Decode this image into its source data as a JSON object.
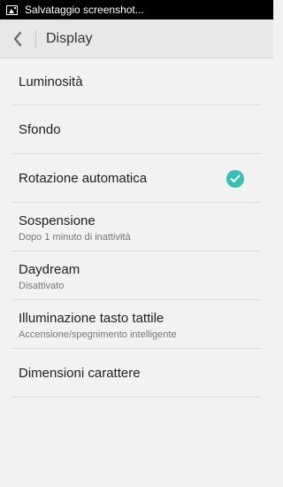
{
  "status_bar": {
    "notification_text": "Salvataggio screenshot...",
    "icon": "image-icon"
  },
  "header": {
    "back_icon": "chevron-left-icon",
    "title": "Display"
  },
  "settings": [
    {
      "id": "brightness",
      "title": "Luminosità",
      "subtitle": null
    },
    {
      "id": "wallpaper",
      "title": "Sfondo",
      "subtitle": null
    },
    {
      "id": "auto-rotate",
      "title": "Rotazione automatica",
      "subtitle": null,
      "checked": true
    },
    {
      "id": "sleep",
      "title": "Sospensione",
      "subtitle": "Dopo 1 minuto di inattività"
    },
    {
      "id": "daydream",
      "title": "Daydream",
      "subtitle": "Disattivato"
    },
    {
      "id": "touch-key-light",
      "title": "Illuminazione tasto tattile",
      "subtitle": "Accensione/spegnimento intelligente"
    },
    {
      "id": "font-size",
      "title": "Dimensioni carattere",
      "subtitle": null
    }
  ],
  "colors": {
    "accent": "#3bbcb4",
    "background": "#f2f2f2",
    "action_bar": "#e8e8e8"
  }
}
